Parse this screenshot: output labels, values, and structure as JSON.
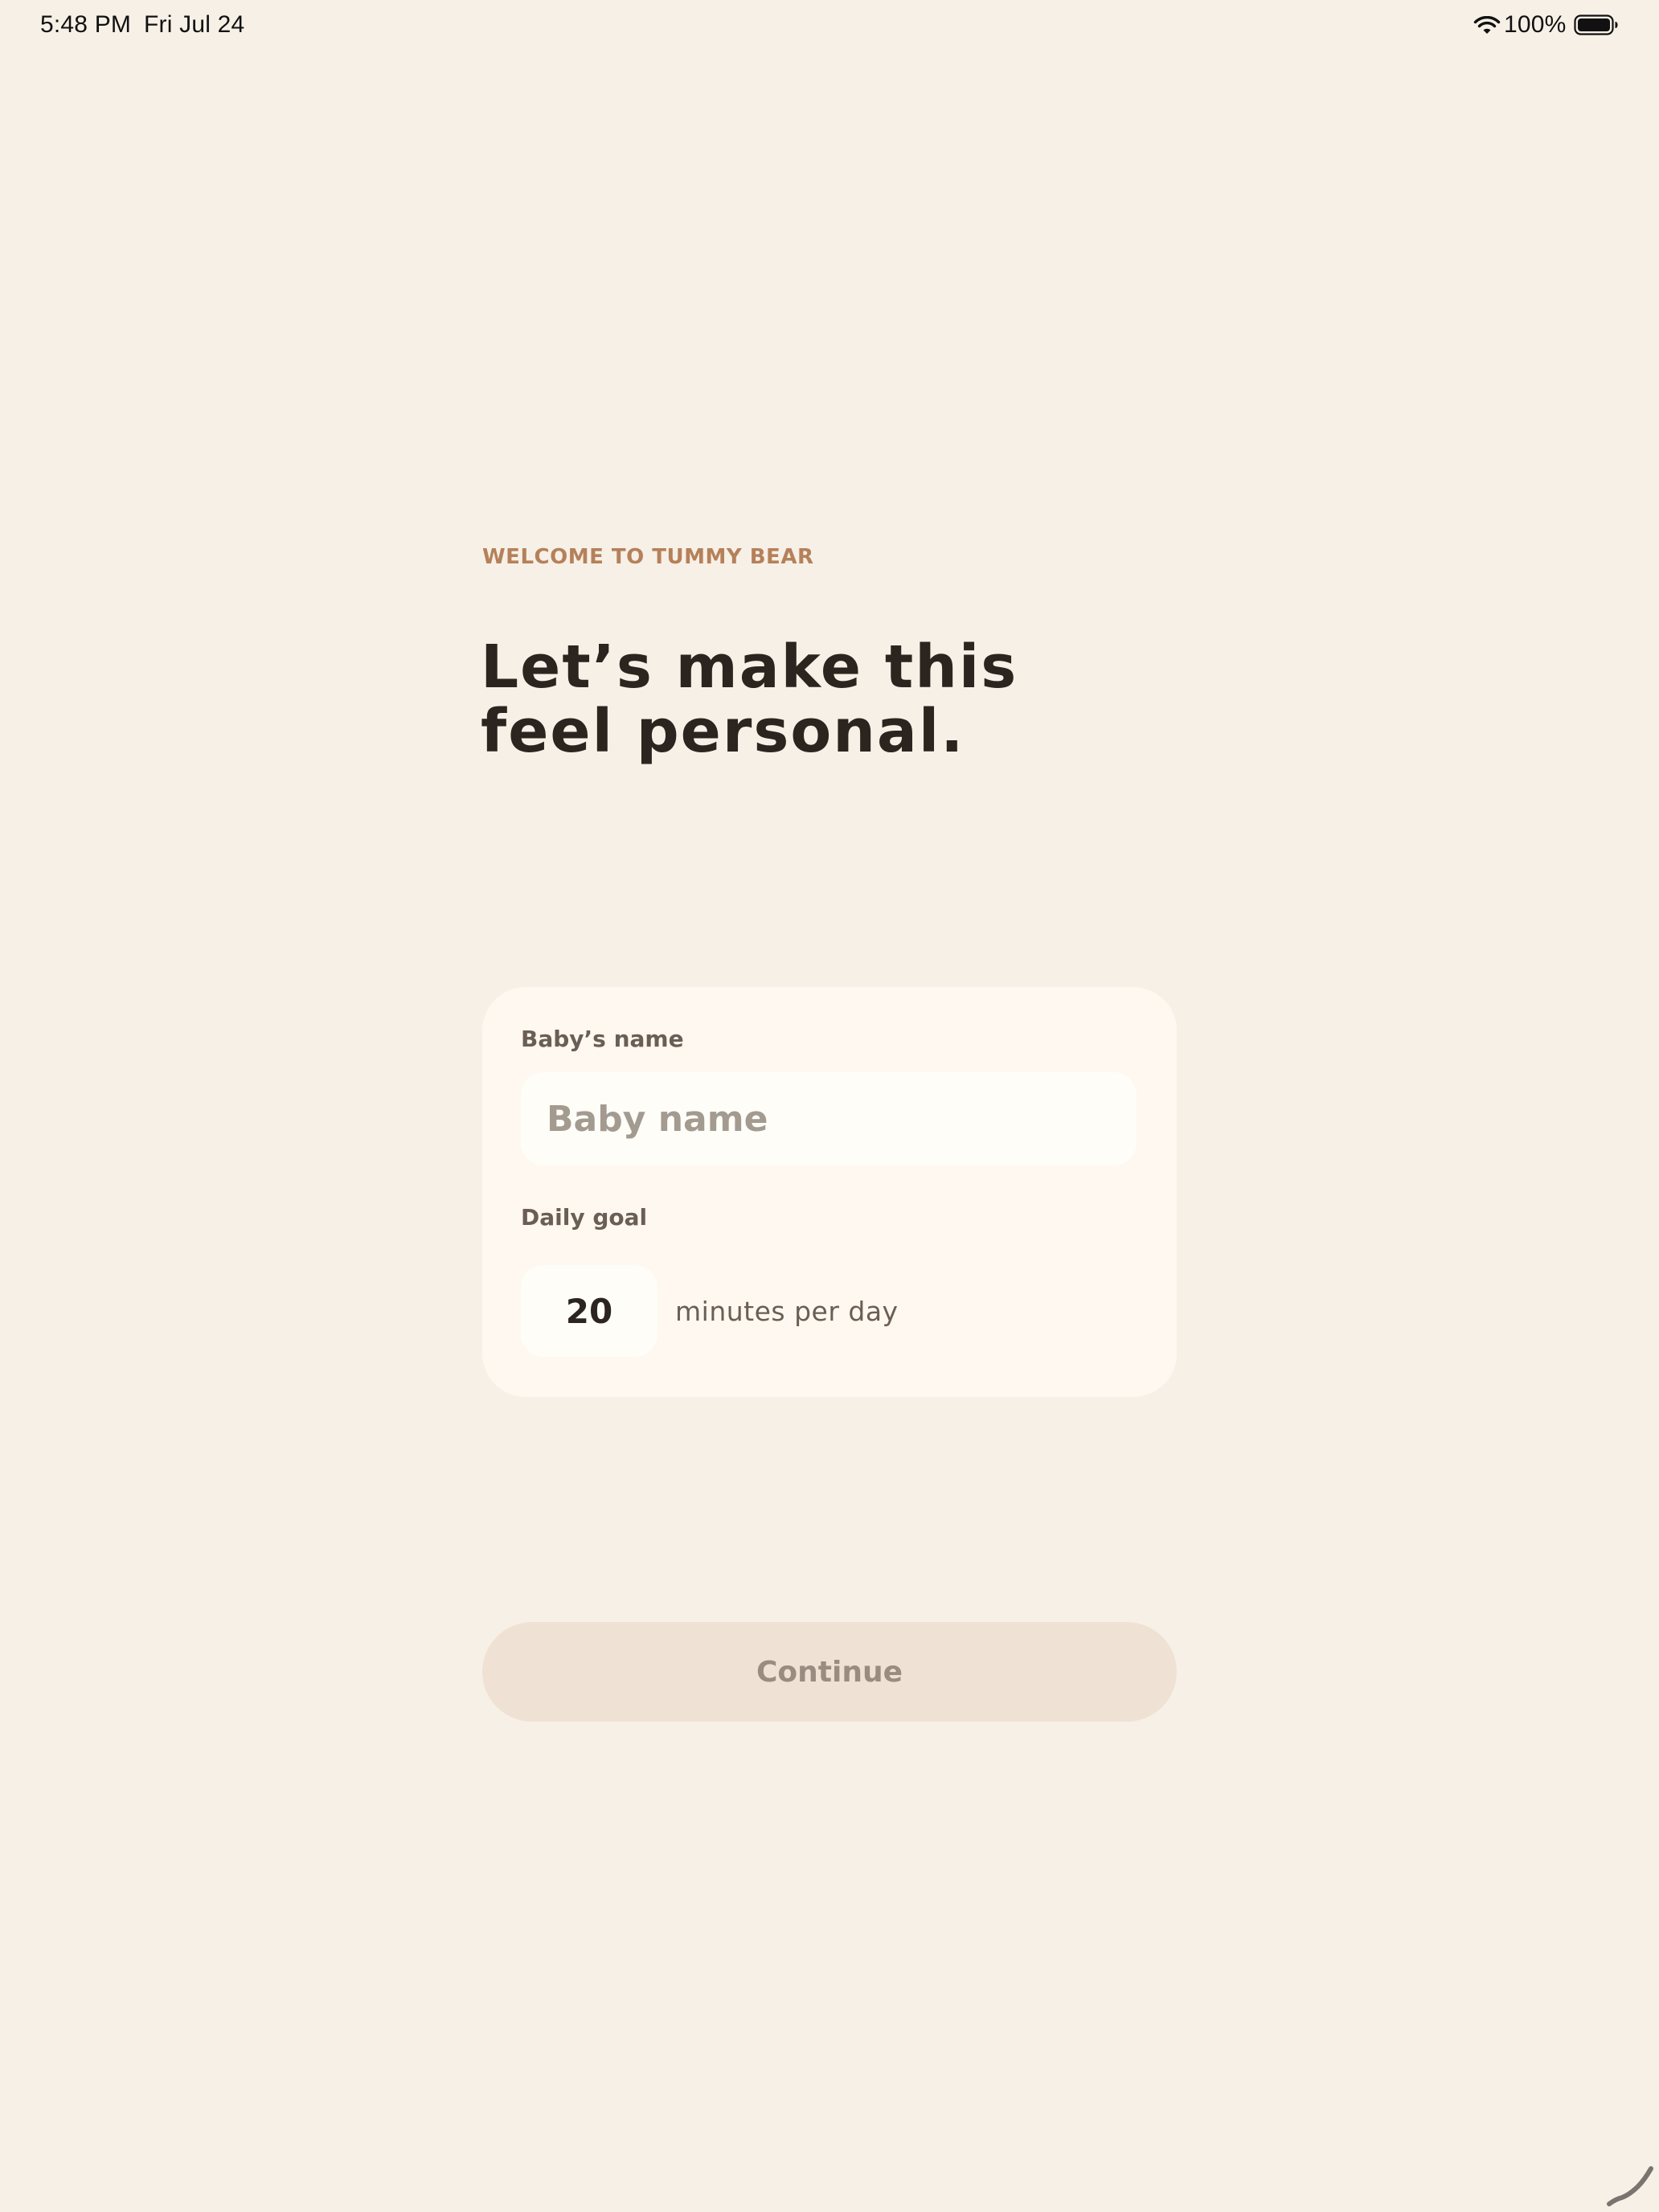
{
  "status_bar": {
    "time": "5:48 PM",
    "date": "Fri Jul 24",
    "battery_percent": "100%",
    "wifi_icon": "wifi-icon",
    "battery_icon": "battery-icon"
  },
  "onboarding": {
    "eyebrow": "WELCOME TO TUMMY BEAR",
    "headline_line1": "Let’s make this",
    "headline_line2": "feel personal."
  },
  "form": {
    "baby_name_label": "Baby’s name",
    "baby_name_value": "",
    "baby_name_placeholder": "Baby name",
    "daily_goal_label": "Daily goal",
    "daily_goal_value": "20",
    "daily_goal_unit": "minutes per day"
  },
  "actions": {
    "continue_label": "Continue",
    "continue_enabled": false
  },
  "colors": {
    "background": "#f7f0e7",
    "card": "#fef8f0",
    "accent": "#b5815a",
    "heading": "#2c241e",
    "button_disabled": "#efe2d4"
  }
}
